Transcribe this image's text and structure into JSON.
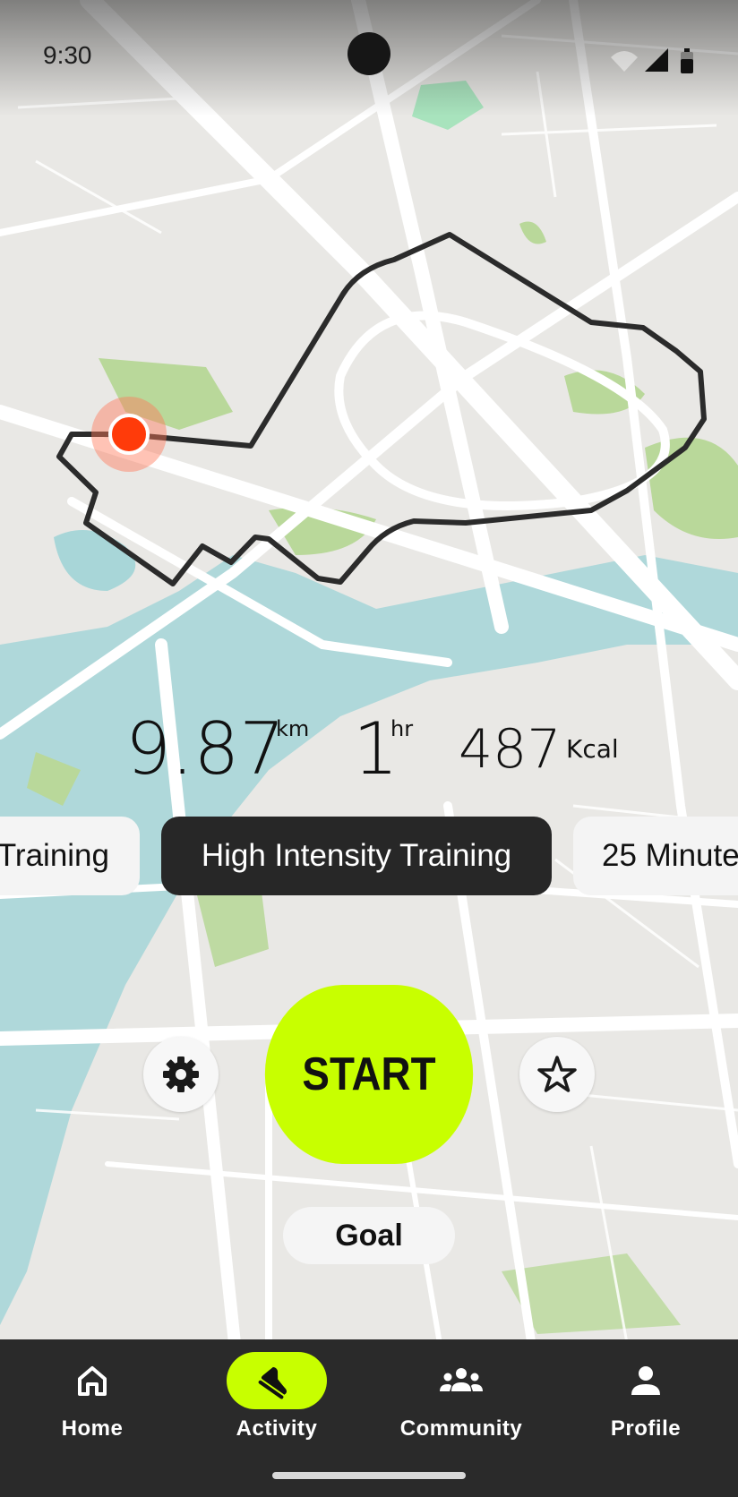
{
  "status_bar": {
    "time": "9:30"
  },
  "stats": {
    "distance_value": "9.87",
    "distance_unit": "km",
    "time_value": "1",
    "time_unit": "hr",
    "calories_value": "487",
    "calories_unit": "Kcal"
  },
  "workout_chips": [
    {
      "label": "Training",
      "selected": false
    },
    {
      "label": "High Intensity Training",
      "selected": true
    },
    {
      "label": "25 Minute",
      "selected": false
    }
  ],
  "controls": {
    "settings_icon": "gear-icon",
    "start_label": "START",
    "favorite_icon": "star-icon",
    "goal_label": "Goal"
  },
  "bottom_nav": {
    "items": [
      {
        "label": "Home",
        "icon": "home-icon",
        "active": false
      },
      {
        "label": "Activity",
        "icon": "sneaker-icon",
        "active": true
      },
      {
        "label": "Community",
        "icon": "people-icon",
        "active": false
      },
      {
        "label": "Profile",
        "icon": "person-icon",
        "active": false
      }
    ]
  },
  "colors": {
    "accent": "#c8ff00",
    "route": "#2b2b2b",
    "location": "#ff3b0a",
    "water": "#a8d6d8",
    "park": "#b9d89a",
    "nav_background": "#2a2a2a"
  }
}
